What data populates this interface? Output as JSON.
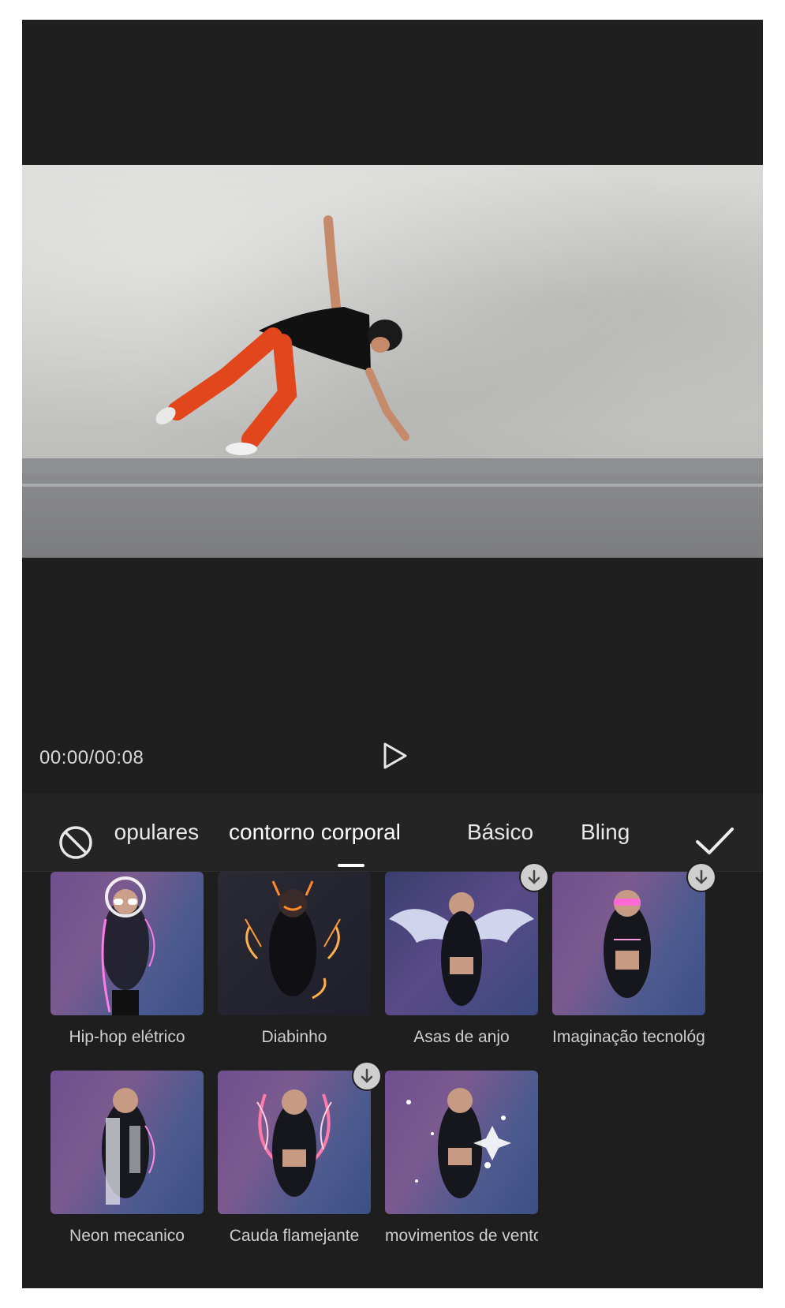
{
  "player": {
    "timecode": "00:00/00:08"
  },
  "effects_tabs": [
    {
      "label": "Populares"
    },
    {
      "label": "contorno corporal",
      "active": true
    },
    {
      "label": "Básico"
    },
    {
      "label": "Bling"
    }
  ],
  "effects": [
    {
      "name": "Hip-hop elétrico",
      "downloadable": false
    },
    {
      "name": "Diabinho",
      "downloadable": false
    },
    {
      "name": "Asas de anjo",
      "downloadable": true
    },
    {
      "name": "Imaginação tecnológica",
      "downloadable": true
    },
    {
      "name": "Neon mecanico",
      "downloadable": false
    },
    {
      "name": "Cauda flamejante",
      "downloadable": true
    },
    {
      "name": "movimentos de vento",
      "downloadable": false
    }
  ],
  "icons": {
    "none": "no-effect-icon",
    "play": "play-icon",
    "confirm": "checkmark-icon",
    "download": "download-arrow-icon"
  },
  "colors": {
    "background": "#1e1e1e",
    "text": "#e8e8e8",
    "accent": "#ffffff",
    "pants": "#e2461c"
  }
}
